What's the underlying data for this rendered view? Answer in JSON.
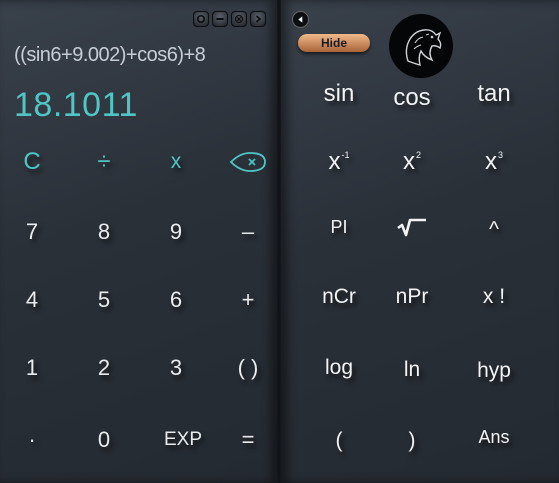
{
  "window": {
    "controls": [
      "record-icon",
      "minimize-icon",
      "close-icon",
      "forward-icon"
    ]
  },
  "display": {
    "expression": "((sin6+9.002)+cos6)+8",
    "result": "18.1011"
  },
  "basic_keys": {
    "clear": "C",
    "divide": "÷",
    "multiply": "x",
    "backspace_icon": "backspace-icon",
    "seven": "7",
    "eight": "8",
    "nine": "9",
    "minus": "–",
    "four": "4",
    "five": "5",
    "six": "6",
    "plus": "+",
    "one": "1",
    "two": "2",
    "three": "3",
    "parens": "( )",
    "dot": "·",
    "zero": "0",
    "exp": "EXP",
    "equals": "="
  },
  "scientific": {
    "hide_label": "Hide",
    "back_icon": "back-arrow-icon",
    "logo_icon": "dragon-logo-icon",
    "sin": "sin",
    "cos": "cos",
    "tan": "tan",
    "x_inverse_base": "x",
    "x_inverse_exp": "-1",
    "x_square_base": "x",
    "x_square_exp": "2",
    "x_cube_base": "x",
    "x_cube_exp": "3",
    "pi": "PI",
    "sqrt_icon": "square-root-icon",
    "power": "^",
    "ncr": "nCr",
    "npr": "nPr",
    "factorial": "x !",
    "log": "log",
    "ln": "ln",
    "hyp": "hyp",
    "open_paren": "(",
    "close_paren": ")",
    "ans": "Ans"
  },
  "colors": {
    "accent": "#4fc6c4",
    "hide_button": "#d38d5c",
    "panel": "#2a3038"
  }
}
